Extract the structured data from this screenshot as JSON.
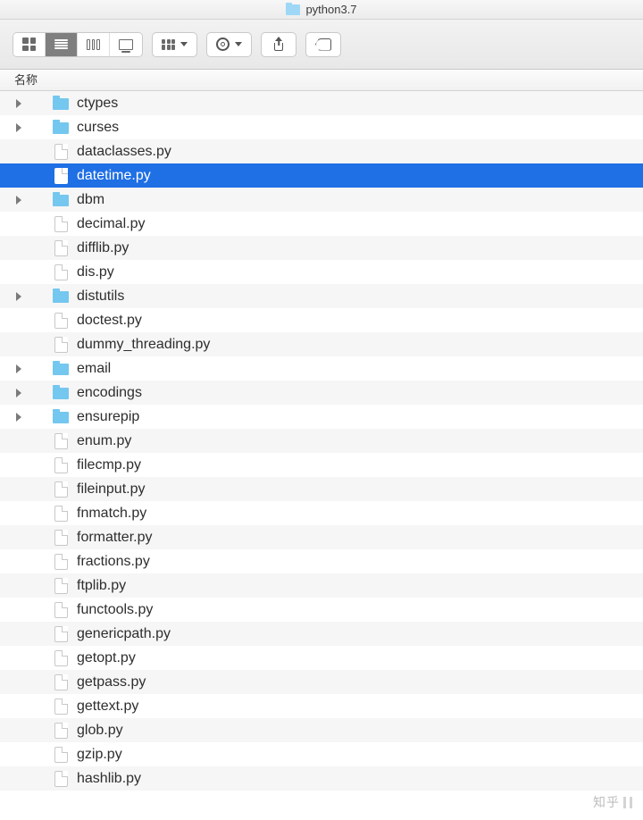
{
  "title": {
    "folder_name": "python3.7"
  },
  "toolbar": {
    "view_icon": "icon-view-icon",
    "view_list": "list-view-icon",
    "view_columns": "column-view-icon",
    "view_gallery": "gallery-view-icon",
    "group_by": "group-by-icon",
    "action": "action-menu-icon",
    "share": "share-icon",
    "tags": "tags-icon"
  },
  "columns": {
    "name_header": "名称"
  },
  "files": [
    {
      "name": "ctypes",
      "type": "folder",
      "expandable": true,
      "selected": false
    },
    {
      "name": "curses",
      "type": "folder",
      "expandable": true,
      "selected": false
    },
    {
      "name": "dataclasses.py",
      "type": "file",
      "expandable": false,
      "selected": false
    },
    {
      "name": "datetime.py",
      "type": "file",
      "expandable": false,
      "selected": true
    },
    {
      "name": "dbm",
      "type": "folder",
      "expandable": true,
      "selected": false
    },
    {
      "name": "decimal.py",
      "type": "file",
      "expandable": false,
      "selected": false
    },
    {
      "name": "difflib.py",
      "type": "file",
      "expandable": false,
      "selected": false
    },
    {
      "name": "dis.py",
      "type": "file",
      "expandable": false,
      "selected": false
    },
    {
      "name": "distutils",
      "type": "folder",
      "expandable": true,
      "selected": false
    },
    {
      "name": "doctest.py",
      "type": "file",
      "expandable": false,
      "selected": false
    },
    {
      "name": "dummy_threading.py",
      "type": "file",
      "expandable": false,
      "selected": false
    },
    {
      "name": "email",
      "type": "folder",
      "expandable": true,
      "selected": false
    },
    {
      "name": "encodings",
      "type": "folder",
      "expandable": true,
      "selected": false
    },
    {
      "name": "ensurepip",
      "type": "folder",
      "expandable": true,
      "selected": false
    },
    {
      "name": "enum.py",
      "type": "file",
      "expandable": false,
      "selected": false
    },
    {
      "name": "filecmp.py",
      "type": "file",
      "expandable": false,
      "selected": false
    },
    {
      "name": "fileinput.py",
      "type": "file",
      "expandable": false,
      "selected": false
    },
    {
      "name": "fnmatch.py",
      "type": "file",
      "expandable": false,
      "selected": false
    },
    {
      "name": "formatter.py",
      "type": "file",
      "expandable": false,
      "selected": false
    },
    {
      "name": "fractions.py",
      "type": "file",
      "expandable": false,
      "selected": false
    },
    {
      "name": "ftplib.py",
      "type": "file",
      "expandable": false,
      "selected": false
    },
    {
      "name": "functools.py",
      "type": "file",
      "expandable": false,
      "selected": false
    },
    {
      "name": "genericpath.py",
      "type": "file",
      "expandable": false,
      "selected": false
    },
    {
      "name": "getopt.py",
      "type": "file",
      "expandable": false,
      "selected": false
    },
    {
      "name": "getpass.py",
      "type": "file",
      "expandable": false,
      "selected": false
    },
    {
      "name": "gettext.py",
      "type": "file",
      "expandable": false,
      "selected": false
    },
    {
      "name": "glob.py",
      "type": "file",
      "expandable": false,
      "selected": false
    },
    {
      "name": "gzip.py",
      "type": "file",
      "expandable": false,
      "selected": false
    },
    {
      "name": "hashlib.py",
      "type": "file",
      "expandable": false,
      "selected": false
    }
  ],
  "watermark": "知乎"
}
